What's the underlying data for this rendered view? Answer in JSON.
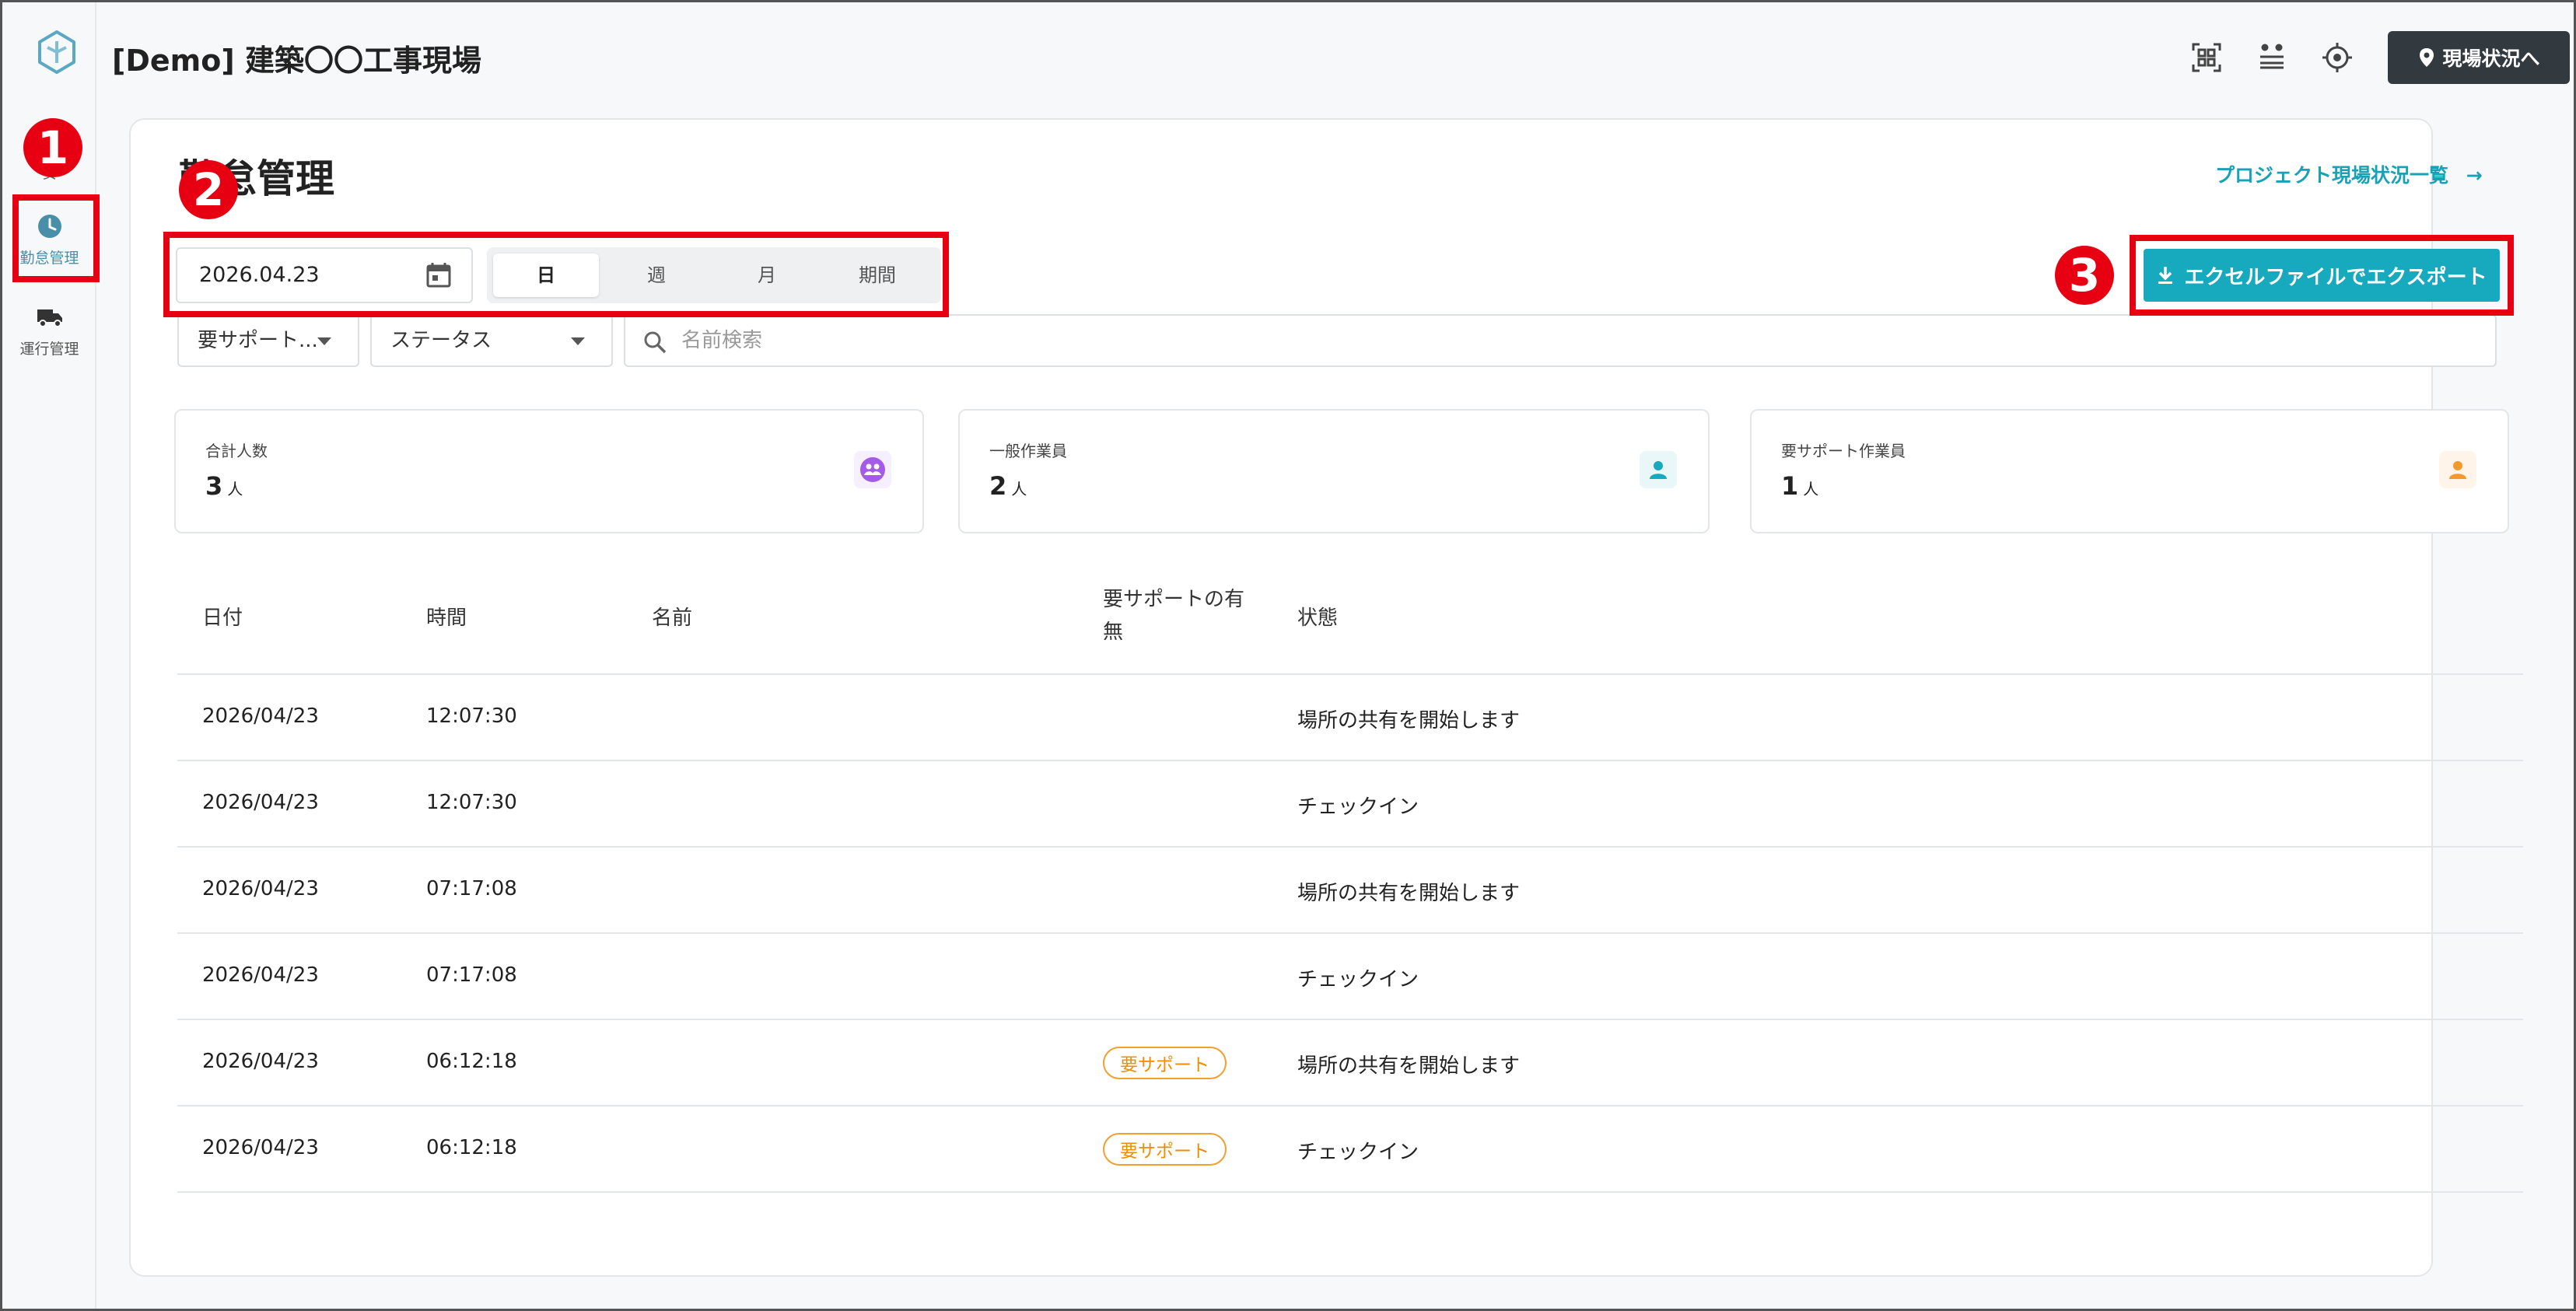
{
  "colors": {
    "accent": "#17a9bd",
    "header_button": "#333a3f",
    "highlight": "#e60012",
    "support_badge": "#f08c00"
  },
  "sidebar": {
    "items": [
      {
        "label": "安",
        "label2": "",
        "icon": "shield-icon"
      },
      {
        "label": "勤怠管理",
        "icon": "clock-icon"
      },
      {
        "label": "運行管理",
        "icon": "truck-icon"
      }
    ]
  },
  "header": {
    "site_title": "[Demo] 建築〇〇工事現場",
    "status_button_label": "現場状況へ",
    "icons": [
      "qr-scan-icon",
      "transfer-icon",
      "location-target-icon"
    ]
  },
  "markers": [
    "❶",
    "❷",
    "❸"
  ],
  "page": {
    "title": "勤怠管理",
    "project_link": "プロジェクト現場状況一覧"
  },
  "date_filter": {
    "value": "2026.04.23",
    "periods": [
      "日",
      "週",
      "月",
      "期間"
    ],
    "active_period": "日"
  },
  "export_button_label": "エクセルファイルでエクスポート",
  "filters": {
    "support": "要サポート...",
    "status": "ステータス",
    "search_placeholder": "名前検索"
  },
  "stats": [
    {
      "label": "合計人数",
      "value": "3",
      "unit": "人"
    },
    {
      "label": "一般作業員",
      "value": "2",
      "unit": "人"
    },
    {
      "label": "要サポート作業員",
      "value": "1",
      "unit": "人"
    }
  ],
  "table": {
    "headers": [
      "日付",
      "時間",
      "名前",
      "要サポートの有",
      "無",
      "状態"
    ],
    "rows": [
      {
        "date": "2026/04/23",
        "time": "12:07:30",
        "name": "",
        "support": "",
        "status": "場所の共有を開始します"
      },
      {
        "date": "2026/04/23",
        "time": "12:07:30",
        "name": "",
        "support": "",
        "status": "チェックイン"
      },
      {
        "date": "2026/04/23",
        "time": "07:17:08",
        "name": "",
        "support": "",
        "status": "場所の共有を開始します"
      },
      {
        "date": "2026/04/23",
        "time": "07:17:08",
        "name": "",
        "support": "",
        "status": "チェックイン"
      },
      {
        "date": "2026/04/23",
        "time": "06:12:18",
        "name": "",
        "support": "要サポート",
        "status": "場所の共有を開始します"
      },
      {
        "date": "2026/04/23",
        "time": "06:12:18",
        "name": "",
        "support": "要サポート",
        "status": "チェックイン"
      }
    ]
  }
}
